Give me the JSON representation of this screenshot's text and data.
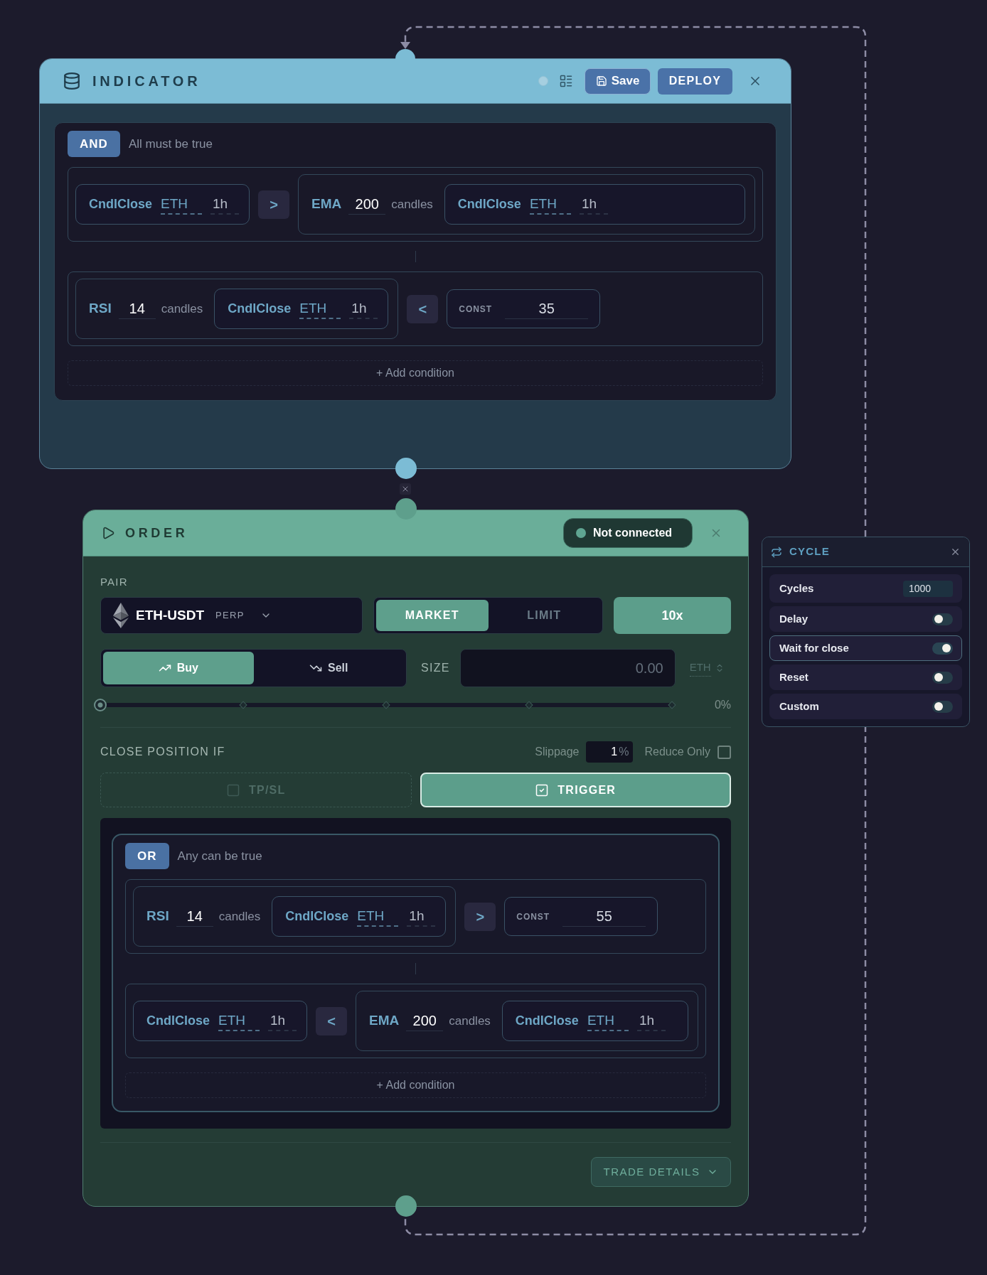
{
  "indicator_node": {
    "title": "INDICATOR",
    "save_label": "Save",
    "deploy_label": "DEPLOY",
    "group": {
      "operator": "AND",
      "description": "All must be true",
      "add_label": "+ Add condition",
      "conditions": [
        {
          "left": {
            "kind": "price",
            "name": "CndlClose",
            "asset": "ETH",
            "timeframe": "1h"
          },
          "comparator": ">",
          "right": {
            "kind": "indicator",
            "name": "EMA",
            "period": "200",
            "unit": "candles",
            "source": {
              "kind": "price",
              "name": "CndlClose",
              "asset": "ETH",
              "timeframe": "1h"
            }
          }
        },
        {
          "left": {
            "kind": "indicator",
            "name": "RSI",
            "period": "14",
            "unit": "candles",
            "source": {
              "kind": "price",
              "name": "CndlClose",
              "asset": "ETH",
              "timeframe": "1h"
            }
          },
          "comparator": "<",
          "right": {
            "kind": "const",
            "label": "CONST",
            "value": "35"
          }
        }
      ]
    }
  },
  "order_node": {
    "title": "ORDER",
    "status": "Not connected",
    "pair_label": "PAIR",
    "pair": {
      "symbol": "ETH-USDT",
      "contract": "PERP"
    },
    "order_types": [
      {
        "label": "MARKET",
        "selected": true
      },
      {
        "label": "LIMIT",
        "selected": false
      }
    ],
    "leverage": "10x",
    "sides": [
      {
        "label": "Buy",
        "kind": "buy",
        "selected": true
      },
      {
        "label": "Sell",
        "kind": "sell",
        "selected": false
      }
    ],
    "size_label": "SIZE",
    "size_placeholder": "0.00",
    "size_unit": "ETH",
    "size_slider": {
      "level": 0
    },
    "size_percent": "0%",
    "close_label": "CLOSE POSITION IF",
    "slippage_label": "Slippage",
    "slippage_value": "1",
    "slippage_unit": "%",
    "reduce_only": {
      "label": "Reduce Only",
      "checked": false
    },
    "close_modes": [
      {
        "label": "TP/SL",
        "selected": false
      },
      {
        "label": "TRIGGER",
        "selected": true
      }
    ],
    "group": {
      "operator": "OR",
      "description": "Any can be true",
      "add_label": "+ Add condition",
      "conditions": [
        {
          "left": {
            "kind": "indicator",
            "name": "RSI",
            "period": "14",
            "unit": "candles",
            "source": {
              "kind": "price",
              "name": "CndlClose",
              "asset": "ETH",
              "timeframe": "1h"
            }
          },
          "comparator": ">",
          "right": {
            "kind": "const",
            "label": "CONST",
            "value": "55"
          }
        },
        {
          "left": {
            "kind": "price",
            "name": "CndlClose",
            "asset": "ETH",
            "timeframe": "1h"
          },
          "comparator": "<",
          "right": {
            "kind": "indicator",
            "name": "EMA",
            "period": "200",
            "unit": "candles",
            "source": {
              "kind": "price",
              "name": "CndlClose",
              "asset": "ETH",
              "timeframe": "1h"
            }
          }
        }
      ]
    },
    "trade_details_label": "TRADE DETAILS"
  },
  "cycle_node": {
    "title": "CYCLE",
    "settings": [
      {
        "kind": "number",
        "label": "Cycles",
        "value": "1000"
      },
      {
        "kind": "toggle",
        "label": "Delay",
        "on": false
      },
      {
        "kind": "toggle",
        "label": "Wait for close",
        "on": true
      },
      {
        "kind": "toggle",
        "label": "Reset",
        "on": false
      },
      {
        "kind": "toggle",
        "label": "Custom",
        "on": false
      }
    ]
  }
}
